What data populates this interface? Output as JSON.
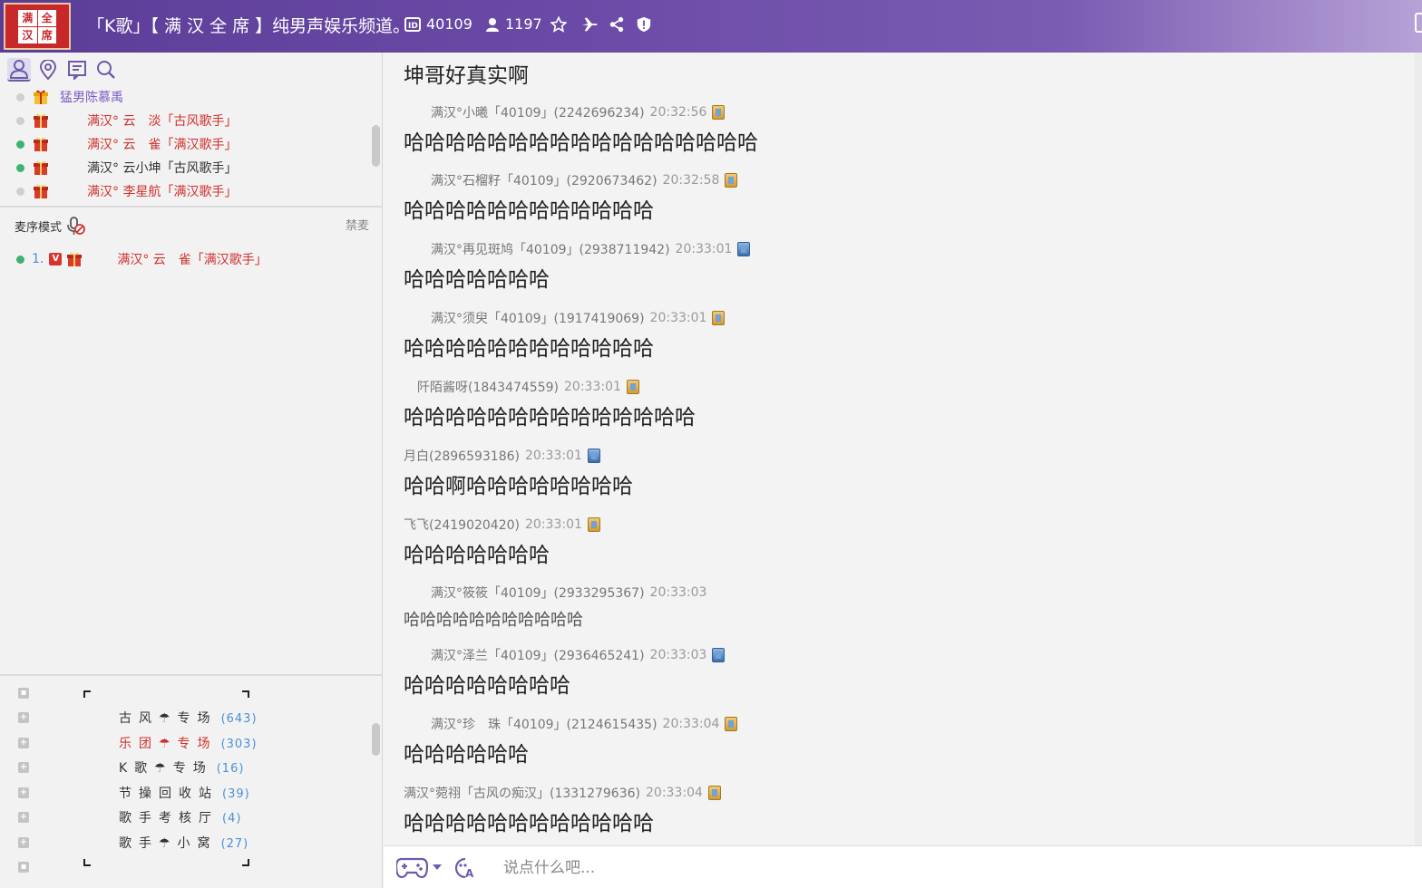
{
  "header": {
    "logo_chars": [
      "满",
      "全",
      "汉",
      "席"
    ],
    "channel_title": "「K歌」【 满 汉 全 席 】纯男声娱乐频道。",
    "channel_id": "40109",
    "online_count": "1197"
  },
  "left_tabs": [
    "user-tab",
    "location-tab",
    "notice-tab",
    "search-tab"
  ],
  "users": [
    {
      "name": "猛男陈慕禹",
      "status": "offline",
      "color": "#7a5cc4"
    },
    {
      "name": "满汉° 云　淡「古风歌手」",
      "status": "offline",
      "color": "#d0312d"
    },
    {
      "name": "满汉° 云　雀「满汉歌手」",
      "status": "online",
      "color": "#d0312d"
    },
    {
      "name": "满汉° 云小坤「古风歌手」",
      "status": "online",
      "color": "#333333"
    },
    {
      "name": "满汉° 李星航「满汉歌手」",
      "status": "offline",
      "color": "#d0312d"
    }
  ],
  "mic": {
    "mode_label": "麦序模式",
    "ban_label": "禁麦",
    "queue_index": "1.",
    "queue_badge": "V",
    "queue_name": "满汉° 云　雀「满汉歌手」"
  },
  "rooms": [
    {
      "name": "古风☂专场",
      "count": "(643)",
      "color": "#333333"
    },
    {
      "name": "乐团☂专场",
      "count": "(303)",
      "color": "#d0312d"
    },
    {
      "name": "K歌☂专场",
      "count": "(16)",
      "color": "#333333"
    },
    {
      "name": "节操回收站",
      "count": "(39)",
      "color": "#333333"
    },
    {
      "name": "歌手考核厅",
      "count": "(4)",
      "color": "#333333"
    },
    {
      "name": "歌手☂小窝",
      "count": "(27)",
      "color": "#333333"
    }
  ],
  "messages": [
    {
      "sender": "",
      "time": "",
      "text": "坤哥好真实啊"
    },
    {
      "sender": "满汉°小曦「40109」(2242696234)",
      "time": "20:32:56",
      "text": "哈哈哈哈哈哈哈哈哈哈哈哈哈哈哈哈哈"
    },
    {
      "sender": "满汉°石榴籽「40109」(2920673462)",
      "time": "20:32:58",
      "text": "哈哈哈哈哈哈哈哈哈哈哈哈"
    },
    {
      "sender": "满汉°再见斑鸠「40109」(2938711942)",
      "time": "20:33:01",
      "text": "哈哈哈哈哈哈哈"
    },
    {
      "sender": "满汉°须臾「40109」(1917419069)",
      "time": "20:33:01",
      "text": "哈哈哈哈哈哈哈哈哈哈哈哈"
    },
    {
      "sender": "阡陌酱呀(1843474559)",
      "time": "20:33:01",
      "text": "哈哈哈哈哈哈哈哈哈哈哈哈哈哈"
    },
    {
      "sender": "月白(2896593186)",
      "time": "20:33:01",
      "text": "哈哈啊哈哈哈哈哈哈哈哈"
    },
    {
      "sender": "飞飞(2419020420)",
      "time": "20:33:01",
      "text": "哈哈哈哈哈哈哈"
    },
    {
      "sender": "满汉°筱筱「40109」(2933295367)",
      "time": "20:33:03",
      "text": "哈哈哈哈哈哈哈哈哈哈哈"
    },
    {
      "sender": "满汉°泽兰「40109」(2936465241)",
      "time": "20:33:03",
      "text": "哈哈哈哈哈哈哈哈"
    },
    {
      "sender": "满汉°珍　珠「40109」(2124615435)",
      "time": "20:33:04",
      "text": "哈哈哈哈哈哈"
    },
    {
      "sender": "满汉°菀祤「古风の痴汉」(1331279636)",
      "time": "20:33:04",
      "text": "哈哈哈哈哈哈哈哈哈哈哈哈"
    }
  ],
  "input": {
    "placeholder": "说点什么吧..."
  }
}
